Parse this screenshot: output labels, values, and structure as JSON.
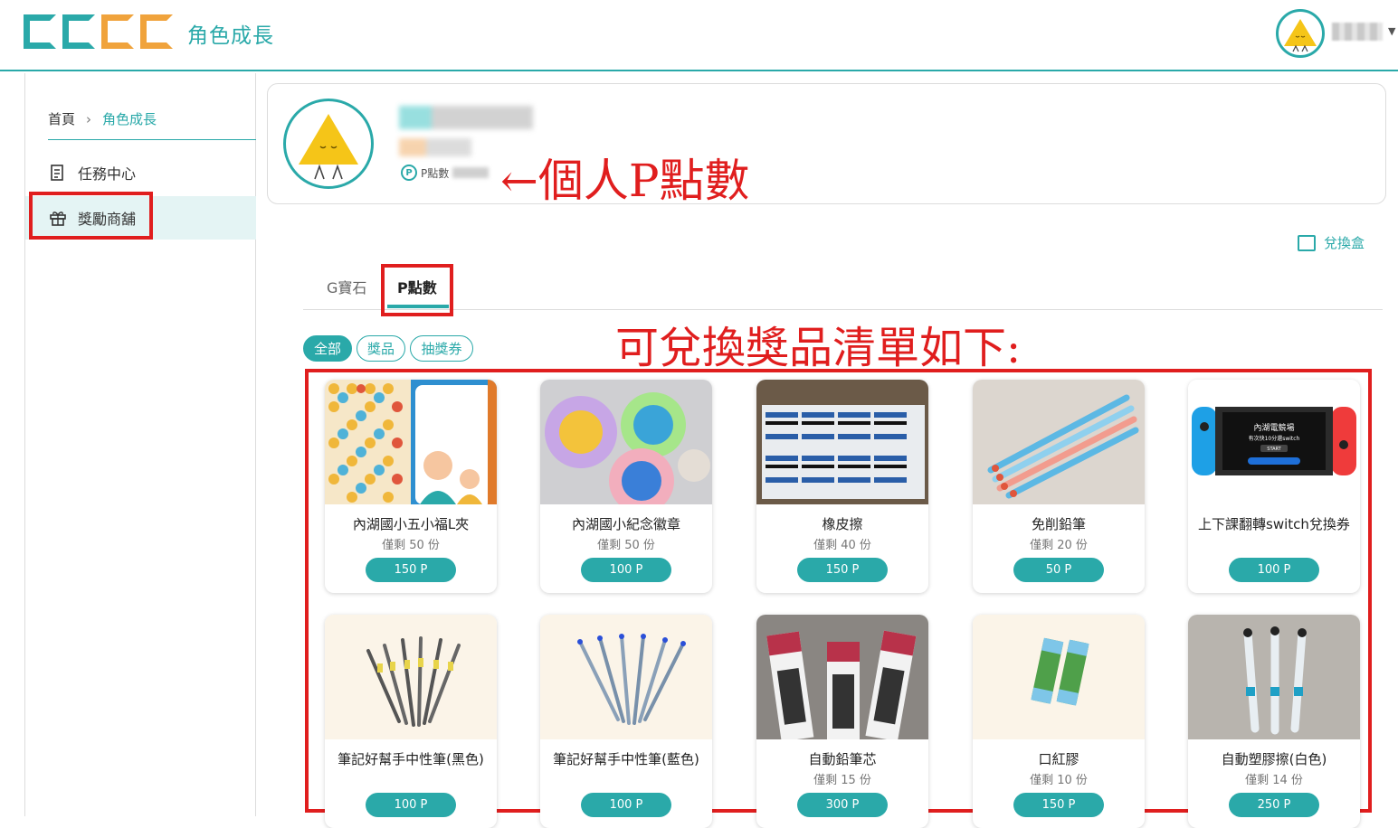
{
  "header": {
    "title": "角色成長"
  },
  "sidebar": {
    "breadcrumb": {
      "home": "首頁",
      "current": "角色成長"
    },
    "items": [
      {
        "label": "任務中心",
        "icon": "scroll-icon"
      },
      {
        "label": "獎勵商舖",
        "icon": "gift-icon"
      }
    ]
  },
  "profile": {
    "points_label": "P點數",
    "p_icon_text": "P"
  },
  "annotations": {
    "points_note": "←個人P點數",
    "list_note": "可兌換獎品清單如下:"
  },
  "exchange_box": {
    "label": "兌換盒"
  },
  "tabs": [
    {
      "label": "G寶石"
    },
    {
      "label": "P點數"
    }
  ],
  "filters": [
    {
      "label": "全部"
    },
    {
      "label": "獎品"
    },
    {
      "label": "抽獎券"
    }
  ],
  "products": [
    {
      "name": "內湖國小五小福L夾",
      "stock": "僅剩 50 份",
      "price": "150 P"
    },
    {
      "name": "內湖國小紀念徽章",
      "stock": "僅剩 50 份",
      "price": "100 P"
    },
    {
      "name": "橡皮擦",
      "stock": "僅剩 40 份",
      "price": "150 P"
    },
    {
      "name": "免削鉛筆",
      "stock": "僅剩 20 份",
      "price": "50 P"
    },
    {
      "name": "上下課翻轉switch兌換券",
      "stock": "",
      "price": "100 P",
      "screen_title": "內湖電競場",
      "screen_sub": "有次快10分還switch",
      "screen_btn": "START"
    },
    {
      "name": "筆記好幫手中性筆(黑色)",
      "stock": "",
      "price": "100 P"
    },
    {
      "name": "筆記好幫手中性筆(藍色)",
      "stock": "",
      "price": "100 P"
    },
    {
      "name": "自動鉛筆芯",
      "stock": "僅剩 15 份",
      "price": "300 P"
    },
    {
      "name": "口紅膠",
      "stock": "僅剩 10 份",
      "price": "150 P"
    },
    {
      "name": "自動塑膠擦(白色)",
      "stock": "僅剩 14 份",
      "price": "250 P"
    }
  ],
  "colors": {
    "accent": "#2aa9a9",
    "annotation": "#e01e1e"
  }
}
